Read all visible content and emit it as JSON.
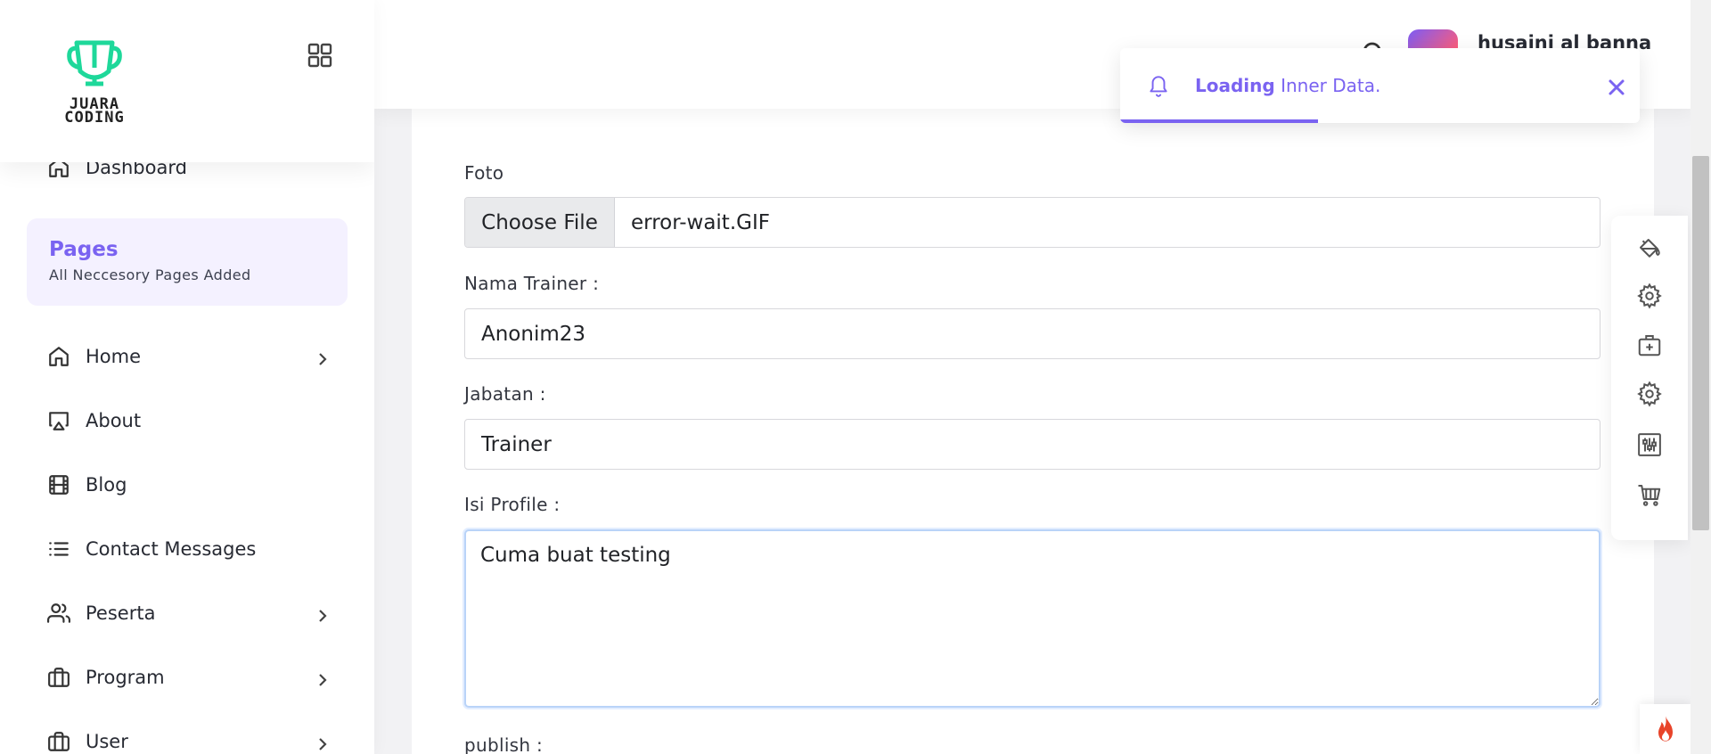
{
  "brand": {
    "logo_line1": "JUARA",
    "logo_line2": "CODING"
  },
  "user": {
    "name": "husaini al banna"
  },
  "sidebar": {
    "dashboard_label": "Dashboard",
    "pages_box": {
      "title": "Pages",
      "subtitle": "All Neccesory Pages Added"
    },
    "items": [
      {
        "label": "Home",
        "icon": "home-icon",
        "has_submenu": true
      },
      {
        "label": "About",
        "icon": "airplay-icon",
        "has_submenu": false
      },
      {
        "label": "Blog",
        "icon": "film-icon",
        "has_submenu": false
      },
      {
        "label": "Contact Messages",
        "icon": "list-icon",
        "has_submenu": false
      },
      {
        "label": "Peserta",
        "icon": "users-icon",
        "has_submenu": true
      },
      {
        "label": "Program",
        "icon": "briefcase-icon",
        "has_submenu": true
      },
      {
        "label": "User",
        "icon": "briefcase-icon",
        "has_submenu": true
      }
    ]
  },
  "form": {
    "foto_label": "Foto",
    "file_button": "Choose File",
    "file_name": "error-wait.GIF",
    "nama_label": "Nama Trainer :",
    "nama_value": "Anonim23",
    "jabatan_label": "Jabatan :",
    "jabatan_value": "Trainer",
    "isi_label": "Isi Profile :",
    "isi_value": "Cuma buat testing",
    "publish_label": "publish :"
  },
  "toast": {
    "strong": "Loading",
    "text": " Inner Data.",
    "progress": 0.38
  },
  "tools": [
    "paint-bucket-icon",
    "settings-icon",
    "medical-box-icon",
    "settings-icon",
    "sliders-icon",
    "cart-icon"
  ],
  "colors": {
    "accent": "#7a63f1",
    "focus_border": "#b9d3f8",
    "fire": "#e8442a"
  }
}
